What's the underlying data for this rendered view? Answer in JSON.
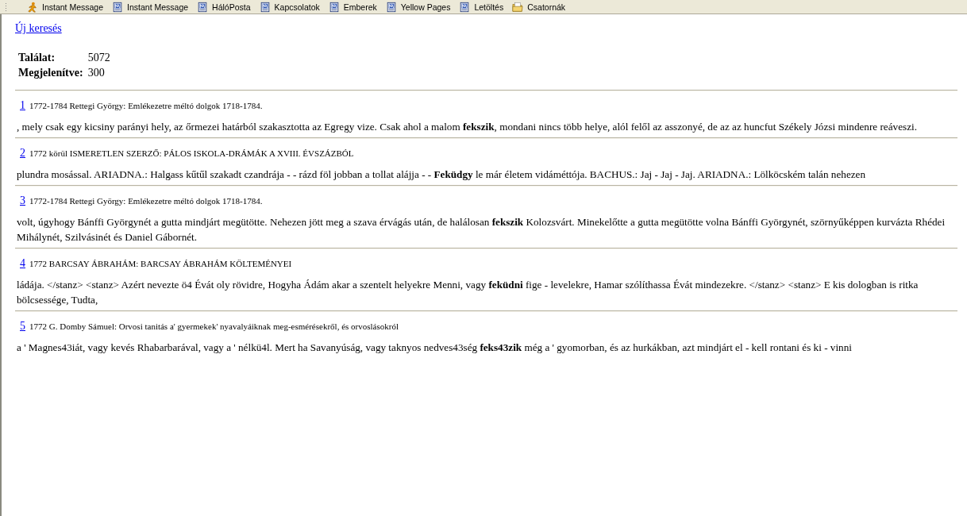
{
  "toolbar": [
    {
      "kind": "person",
      "label": "Instant Message"
    },
    {
      "kind": "page",
      "label": "Instant Message"
    },
    {
      "kind": "page",
      "label": "HálóPosta"
    },
    {
      "kind": "page",
      "label": "Kapcsolatok"
    },
    {
      "kind": "page",
      "label": "Emberek"
    },
    {
      "kind": "page",
      "label": "Yellow Pages"
    },
    {
      "kind": "page",
      "label": "Letöltés"
    },
    {
      "kind": "folder",
      "label": "Csatornák"
    }
  ],
  "new_search_link": "Új keresés",
  "summary": [
    {
      "label": "Találat:",
      "value": "5072"
    },
    {
      "label": "Megjelenítve:",
      "value": "300"
    }
  ],
  "results": [
    {
      "number": "1",
      "source": "1772-1784 Rettegi György: Emlékezetre méltó dolgok 1718-1784.",
      "snippet": ", mely csak egy kicsiny parányi hely, az őrmezei határból szakasztotta az Egregy vize. Csak ahol a malom **fekszik**, mondani nincs több helye, alól felől az asszonyé, de az az huncfut Székely Józsi mindenre reáveszi."
    },
    {
      "number": "2",
      "source": "1772 körül ISMERETLEN SZERZŐ: PÁLOS ISKOLA-DRÁMÁK A XVIII. ÉVSZÁZBÓL",
      "snippet": "plundra mosással. ARIADNA.: Halgass kűtűl szakadt czandrája - - rázd föl jobban a tollat alájja - - **Feküdgy** le már életem vidáméttója. BACHUS.: Jaj - Jaj - Jaj. ARIADNA.: Lölköcském talán nehezen"
    },
    {
      "number": "3",
      "source": "1772-1784 Rettegi György: Emlékezetre méltó dolgok 1718-1784.",
      "snippet": "volt, úgyhogy Bánffi Györgynét a gutta mindjárt megütötte. Nehezen jött meg a szava érvágás után, de halálosan **fekszik** Kolozsvárt. Minekelőtte a gutta megütötte volna Bánffi Györgynét, szörnyűképpen kurvázta Rhédei Mihálynét, Szilvásinét és Daniel Gábornét."
    },
    {
      "number": "4",
      "source": "1772 BARCSAY ÁBRAHÁM: BARCSAY ÁBRAHÁM KÖLTEMÉNYEI",
      "snippet": "ládája. </stanz> <stanz> Azért nevezte ö4 Évát oly rövidre, Hogyha Ádám akar a szentelt helyekre Menni, vagy **feküdni** fige - levelekre, Hamar szólíthassa Évát mindezekre. </stanz> <stanz> E kis dologban is ritka bölcsessége, Tudta,"
    },
    {
      "number": "5",
      "source": "1772 G. Domby Sámuel: Orvosi tanitás a' gyermekek' nyavalyáiknak meg-esmérésekről, és orvoslásokról",
      "snippet": "a ' Magnes43iát, vagy kevés Rhabarbarával, vagy a ' nélkü4l. Mert ha Savanyúság, vagy taknyos nedves43ség **feks43zik** még a ' gyomorban, és az hurkákban, azt mindjárt el - kell rontani és ki - vinni"
    }
  ]
}
